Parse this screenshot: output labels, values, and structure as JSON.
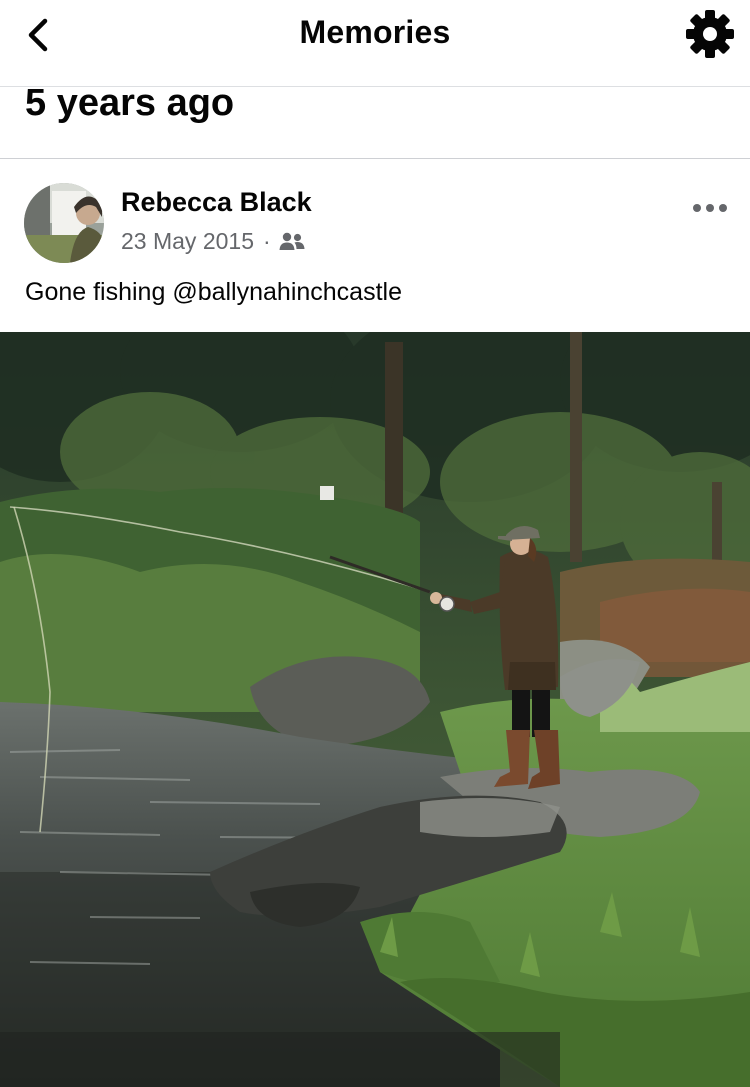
{
  "header": {
    "title": "Memories",
    "back_icon": "chevron-left-icon",
    "settings_icon": "gear-icon"
  },
  "section": {
    "heading": "5 years ago"
  },
  "post": {
    "author": "Rebecca Black",
    "date": "23 May 2015",
    "separator": "·",
    "audience_icon": "friends-icon",
    "more_icon": "more-horizontal-icon",
    "caption": "Gone fishing @ballynahinchcastle"
  },
  "colors": {
    "text": "#050505",
    "secondary": "#65676b",
    "divider": "#ced0d4"
  }
}
